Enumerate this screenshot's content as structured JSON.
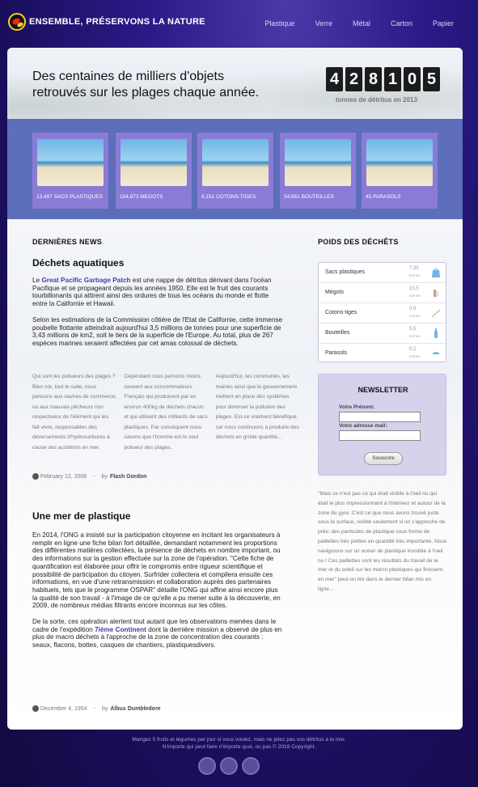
{
  "brand": {
    "title": "ENSEMBLE, PRÉSERVONS LA NATURE"
  },
  "nav": [
    "Plastique",
    "Verre",
    "Métal",
    "Carton",
    "Papier"
  ],
  "hero": {
    "title": "Des centaines de milliers d'objets retrouvés sur les plages chaque année.",
    "counter_digits": [
      "4",
      "2",
      "8",
      "1",
      "0",
      "5"
    ],
    "counter_label": "tonnes de détritus en 2013"
  },
  "tiles": [
    {
      "caption": "13,497 SACS PLASTIQUES"
    },
    {
      "caption": "154,873 MEGOTS"
    },
    {
      "caption": "8,151 COTONS-TIGES"
    },
    {
      "caption": "54,651 BOUTEILLES"
    },
    {
      "caption": "45 PARASOLS"
    }
  ],
  "news": {
    "heading": "DERNIÈRES NEWS",
    "article1": {
      "title": "Déchets aquatiques",
      "p1_prefix": "Le ",
      "p1_link": "Great Pacific Garbage Patch",
      "p1_rest": " est une nappe de détritus dérivant dans l'océan Pacifique et se propageant depuis les années 1950. Elle est le fruit des courants tourbillonants qui attirent ainsi des ordures de tous les océans du monde et flotte entre la Californie et Hawaii.",
      "p2": "Selon les estimations de la Commission côtière de l'Etat de Californie, cette immense poubelle flottante atteindrait aujourd'hui 3,5 millions de tonnes pour une superficie de 3,43 millions de km2, soit le tiers de la superficie de l'Europe. Au total, plus de 267 espèces marines seraient affectées par cet amas colossal de déchets.",
      "cols": [
        "Qui sont les pollueurs des plages ? Bien sûr, tout le suite, nous pensons aux navires de commerce, ou aux mauvais pêcheurs non respectueux de l'élément qui les fait vivre, responsables des déversements d'hydrocarbures à cause des accidents en mer.",
        "Cependant nous pensons moins souvent aux consommateurs Français qui produisent par an environ 400kg de déchets chacun et qui utilisent des milliards de sacs plastiques. Par conséquent nous savons que l'homme est le seul pollueur des plages.",
        "Aujourd'hui, les communes, les mairies ainsi que le gouvernement mettent en place des systèmes pour diminuer la pollution des plages. Est-ce vraiment bénéfique, car nous continuons à produire des déchets en grnde quantité..."
      ],
      "date": "February 12, 2008",
      "by": "by",
      "author": "Flash Gordon"
    },
    "article2": {
      "title": "Une mer de plastique",
      "p1": "En 2014, l'ONG a insisté sur la participation citoyenne en incitant les organisateurs à remplir en ligne une fiche bilan fort détaillée, demandant notamment les proportions des différentes matières collectées, la présence de déchets en nombre important, ou des informations sur la gestion effectuée sur la zone de l'opération. \"Cette fiche de quantification est élaborée pour offrir le compromis entre rigueur scientifique et possibilité de participation du citoyen. Surfrider collectera et compilera ensuite ces informations, en vue d'une retransmission et collaboration auprès des partenaires habituels, tels que le programme OSPAR\" détaille l'ONG qui affine ainsi encore plus la qualité de son travail - à l'image de ce qu'elle a pu mener suite à la découverte, en 2009, de nombreux médias filtrants encore inconnus sur les côtes.",
      "p2_prefix": "De la sorte, ces opération alertent tout autant que les observations menées dans le cadre de l'expédition ",
      "p2_link": "7ième Continent",
      "p2_rest": " dont la dernière mission a observé de plus en plus de macro déchets à l'approche de la zone de concentration des courants : seaux, flacons, bottes, casques de chantiers, plastiquesdivers.",
      "date": "December 4, 1954",
      "by": "by",
      "author": "Albus Dumbledore"
    }
  },
  "weights": {
    "heading": "POIDS DES DÉCHÊTS",
    "unit": "tonnes",
    "rows": [
      {
        "name": "Sacs plastiques",
        "value": "7,35",
        "icon": "bag-icon"
      },
      {
        "name": "Mégots",
        "value": "15,5",
        "icon": "cigarette-icon"
      },
      {
        "name": "Cotons-tiges",
        "value": "0,8",
        "icon": "cotton-swab-icon"
      },
      {
        "name": "Bouteilles",
        "value": "5,5",
        "icon": "bottle-icon"
      },
      {
        "name": "Parasols",
        "value": "0,2",
        "icon": "parasol-icon"
      }
    ]
  },
  "newsletter": {
    "title": "NEWSLETTER",
    "first_name_label": "Votre Prénom:",
    "email_label": "Votre adresse mail:",
    "button": "Souscrire"
  },
  "quote": "\"Mais ce n'est pas ce qui était visible à l'oeil nu qui était le plus impressionnant à l'intérieur et autour de la zone du gyre. C'est ce que nous avons trouvé juste sous la surface, visible seulement si on s'approche de près: des particules de plastique sous forme de paillettes très petites en quantité très importante. Nous naviguions sur un océan de plastique invisible à l'oeil nu ! Ces paillettes sont les résultats du travail de la mer et du soleil sur les macro plastiques qui finissent en mer\" peut-on lire dans le dernier bilan mis en ligne...",
  "footer": {
    "line1": "Mangez 5 fruits et légumes par jour si vous voulez, mais ne jetez pas vos détritus à la mer.",
    "line2": "N'importe qui peut faire n'importe quoi, ou pas © 2018 Copyright."
  }
}
